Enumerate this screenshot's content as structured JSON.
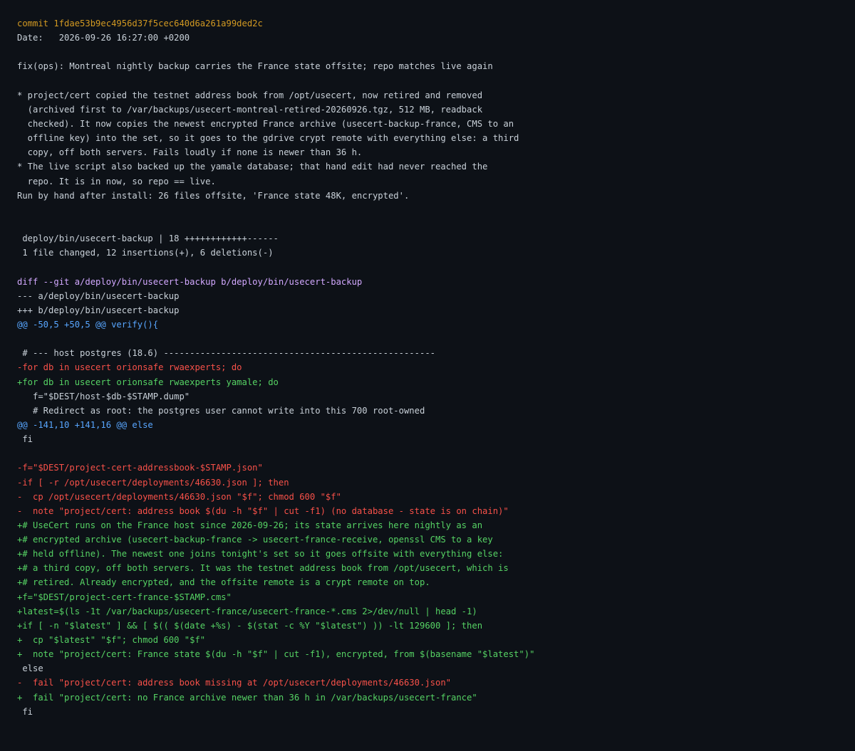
{
  "commit": {
    "hash_line": "commit 1fdae53b9ec4956d37f5cec640d6a261a99ded2c",
    "date_line": "Date:   2026-09-26 16:27:00 +0200"
  },
  "colors": {
    "background": "#0d1117",
    "text": "#c9d1d9",
    "commit": "#d29922",
    "meta": "#d2a8ff",
    "hunk": "#58a6ff",
    "added": "#56d364",
    "removed": "#f85149"
  },
  "lines": [
    {
      "kind": "commit",
      "text": "commit 1fdae53b9ec4956d37f5cec640d6a261a99ded2c"
    },
    {
      "kind": "header",
      "text": "Date:   2026-09-26 16:27:00 +0200"
    },
    {
      "kind": "blank",
      "text": ""
    },
    {
      "kind": "plain",
      "text": "fix(ops): Montreal nightly backup carries the France state offsite; repo matches live again"
    },
    {
      "kind": "blank",
      "text": ""
    },
    {
      "kind": "plain",
      "text": "* project/cert copied the testnet address book from /opt/usecert, now retired and removed"
    },
    {
      "kind": "plain",
      "text": "  (archived first to /var/backups/usecert-montreal-retired-20260926.tgz, 512 MB, readback"
    },
    {
      "kind": "plain",
      "text": "  checked). It now copies the newest encrypted France archive (usecert-backup-france, CMS to an"
    },
    {
      "kind": "plain",
      "text": "  offline key) into the set, so it goes to the gdrive crypt remote with everything else: a third"
    },
    {
      "kind": "plain",
      "text": "  copy, off both servers. Fails loudly if none is newer than 36 h."
    },
    {
      "kind": "plain",
      "text": "* The live script also backed up the yamale database; that hand edit had never reached the"
    },
    {
      "kind": "plain",
      "text": "  repo. It is in now, so repo == live."
    },
    {
      "kind": "plain",
      "text": "Run by hand after install: 26 files offsite, 'France state 48K, encrypted'."
    },
    {
      "kind": "blank",
      "text": ""
    },
    {
      "kind": "blank",
      "text": ""
    },
    {
      "kind": "plain",
      "text": " deploy/bin/usecert-backup | 18 ++++++++++++------"
    },
    {
      "kind": "plain",
      "text": " 1 file changed, 12 insertions(+), 6 deletions(-)"
    },
    {
      "kind": "blank",
      "text": ""
    },
    {
      "kind": "meta",
      "text": "diff --git a/deploy/bin/usecert-backup b/deploy/bin/usecert-backup"
    },
    {
      "kind": "file",
      "text": "--- a/deploy/bin/usecert-backup"
    },
    {
      "kind": "file",
      "text": "+++ b/deploy/bin/usecert-backup"
    },
    {
      "kind": "hunk",
      "text": "@@ -50,5 +50,5 @@ verify(){"
    },
    {
      "kind": "blank",
      "text": ""
    },
    {
      "kind": "ctx",
      "text": " # --- host postgres (18.6) ----------------------------------------------------"
    },
    {
      "kind": "del",
      "text": "-for db in usecert orionsafe rwaexperts; do"
    },
    {
      "kind": "add",
      "text": "+for db in usecert orionsafe rwaexperts yamale; do"
    },
    {
      "kind": "ctx",
      "text": "   f=\"$DEST/host-$db-$STAMP.dump\""
    },
    {
      "kind": "ctx",
      "text": "   # Redirect as root: the postgres user cannot write into this 700 root-owned"
    },
    {
      "kind": "hunk",
      "text": "@@ -141,10 +141,16 @@ else"
    },
    {
      "kind": "ctx",
      "text": " fi"
    },
    {
      "kind": "blank",
      "text": ""
    },
    {
      "kind": "del",
      "text": "-f=\"$DEST/project-cert-addressbook-$STAMP.json\""
    },
    {
      "kind": "del",
      "text": "-if [ -r /opt/usecert/deployments/46630.json ]; then"
    },
    {
      "kind": "del",
      "text": "-  cp /opt/usecert/deployments/46630.json \"$f\"; chmod 600 \"$f\""
    },
    {
      "kind": "del",
      "text": "-  note \"project/cert: address book $(du -h \"$f\" | cut -f1) (no database - state is on chain)\""
    },
    {
      "kind": "add",
      "text": "+# UseCert runs on the France host since 2026-09-26; its state arrives here nightly as an"
    },
    {
      "kind": "add",
      "text": "+# encrypted archive (usecert-backup-france -> usecert-france-receive, openssl CMS to a key"
    },
    {
      "kind": "add",
      "text": "+# held offline). The newest one joins tonight's set so it goes offsite with everything else:"
    },
    {
      "kind": "add",
      "text": "+# a third copy, off both servers. It was the testnet address book from /opt/usecert, which is"
    },
    {
      "kind": "add",
      "text": "+# retired. Already encrypted, and the offsite remote is a crypt remote on top."
    },
    {
      "kind": "add",
      "text": "+f=\"$DEST/project-cert-france-$STAMP.cms\""
    },
    {
      "kind": "add",
      "text": "+latest=$(ls -1t /var/backups/usecert-france/usecert-france-*.cms 2>/dev/null | head -1)"
    },
    {
      "kind": "add",
      "text": "+if [ -n \"$latest\" ] && [ $(( $(date +%s) - $(stat -c %Y \"$latest\") )) -lt 129600 ]; then"
    },
    {
      "kind": "add",
      "text": "+  cp \"$latest\" \"$f\"; chmod 600 \"$f\""
    },
    {
      "kind": "add",
      "text": "+  note \"project/cert: France state $(du -h \"$f\" | cut -f1), encrypted, from $(basename \"$latest\")\""
    },
    {
      "kind": "ctx",
      "text": " else"
    },
    {
      "kind": "del",
      "text": "-  fail \"project/cert: address book missing at /opt/usecert/deployments/46630.json\""
    },
    {
      "kind": "add",
      "text": "+  fail \"project/cert: no France archive newer than 36 h in /var/backups/usecert-france\""
    },
    {
      "kind": "ctx",
      "text": " fi"
    }
  ]
}
